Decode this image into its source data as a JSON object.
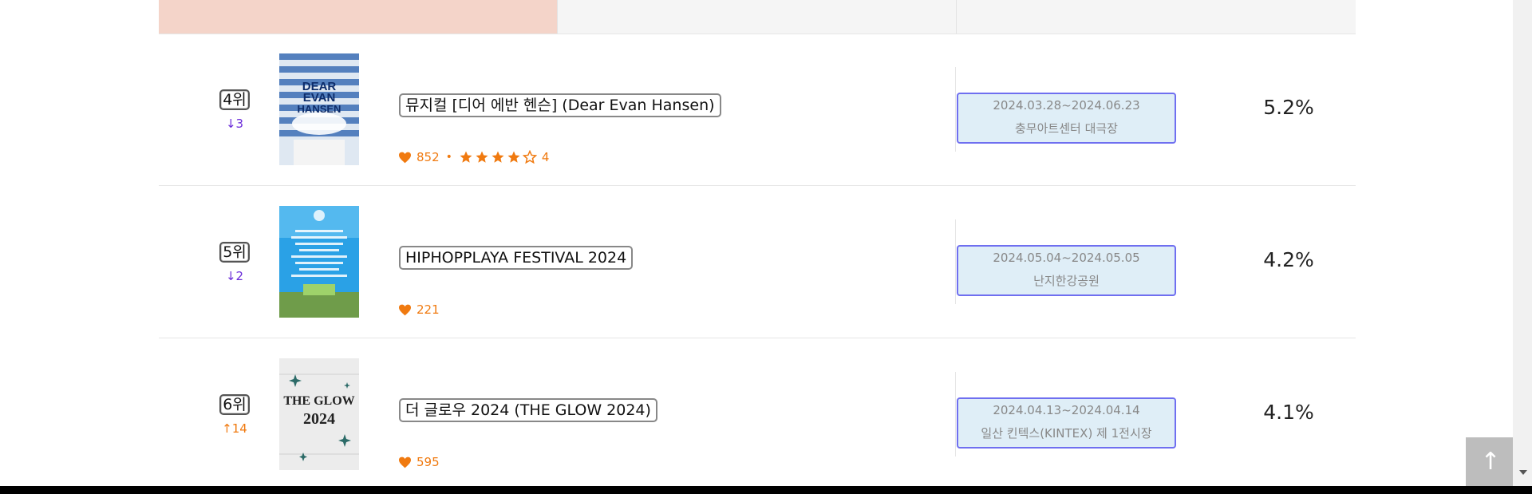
{
  "colors": {
    "accent_orange": "#f07a10",
    "down_purple": "#6a2bd9",
    "box_border": "#6f6ff0",
    "box_bg": "#dfeef7"
  },
  "rows": [
    {
      "rank": "4위",
      "change": "↓3",
      "change_dir": "down",
      "title": "뮤지컬 [디어 에반 헨슨] (Dear Evan Hansen)",
      "likes": "852",
      "rating": "4",
      "rating_stars": 4,
      "date": "2024.03.28~2024.06.23",
      "venue": "충무아트센터 대극장",
      "share": "5.2%",
      "poster_text": [
        "DEAR",
        "EVAN",
        "HANSEN"
      ]
    },
    {
      "rank": "5위",
      "change": "↓2",
      "change_dir": "down",
      "title": "HIPHOPPLAYA FESTIVAL 2024",
      "likes": "221",
      "rating": "",
      "rating_stars": 0,
      "date": "2024.05.04~2024.05.05",
      "venue": "난지한강공원",
      "share": "4.2%",
      "poster_text": []
    },
    {
      "rank": "6위",
      "change": "↑14",
      "change_dir": "up",
      "title": "더 글로우 2024 (THE GLOW 2024)",
      "likes": "595",
      "rating": "",
      "rating_stars": 0,
      "date": "2024.04.13~2024.04.14",
      "venue": "일산 킨텍스(KINTEX) 제 1전시장",
      "share": "4.1%",
      "poster_text": [
        "THE GLOW",
        "2024"
      ]
    }
  ],
  "top_button": {
    "label": "↑"
  }
}
